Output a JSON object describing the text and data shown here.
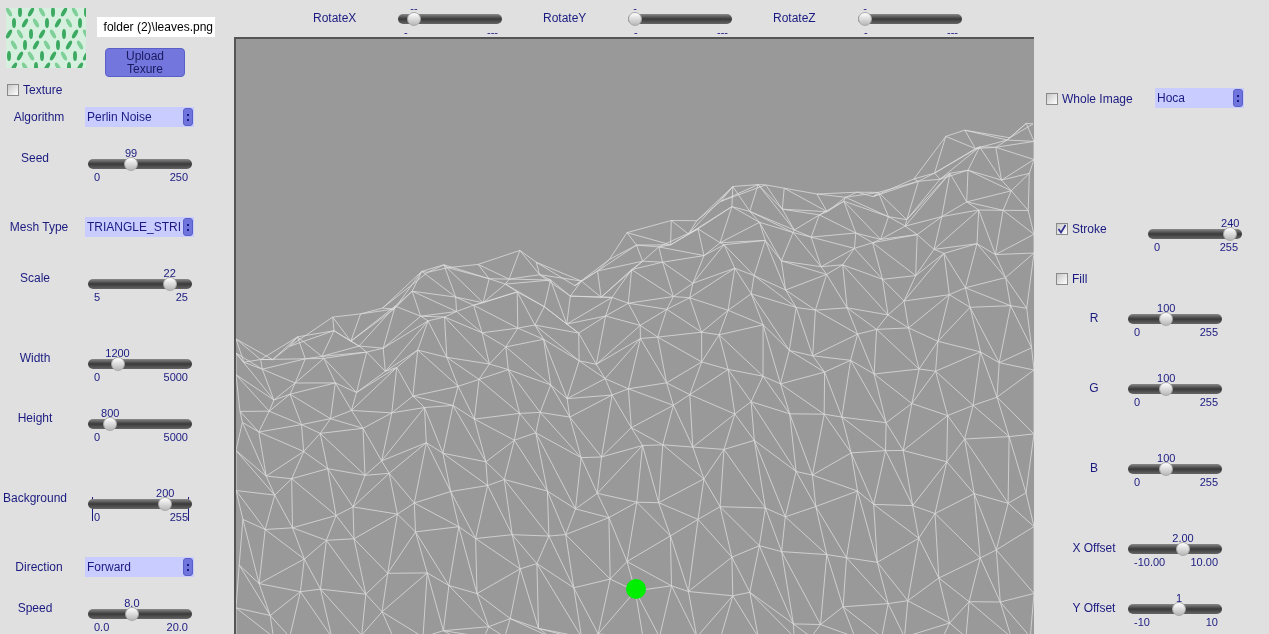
{
  "top_sliders": [
    {
      "label": "RotateX",
      "value": "--",
      "min": "-",
      "max": "---",
      "level": 0.1
    },
    {
      "label": "RotateY",
      "value": "-",
      "min": "-",
      "max": "---",
      "level": 0.0
    },
    {
      "label": "RotateZ",
      "value": "-",
      "min": "-",
      "max": "---",
      "level": 0.0
    }
  ],
  "texture": {
    "file_path": "folder (2)\\leaves.png",
    "upload_button": "Upload Texure",
    "checkbox": {
      "label": "Texture",
      "checked": false
    }
  },
  "left_controls": [
    {
      "kind": "dropdown",
      "label": "Algorithm",
      "value": "Perlin Noise"
    },
    {
      "kind": "slider",
      "label": "Seed",
      "value": "99",
      "min": "0",
      "max": "250",
      "level": 0.4,
      "ticks": false
    },
    {
      "kind": "dropdown",
      "label": "Mesh Type",
      "value": "TRIANGLE_STRI"
    },
    {
      "kind": "slider",
      "label": "Scale",
      "value": "22",
      "min": "5",
      "max": "25",
      "level": 0.83,
      "ticks": false
    },
    {
      "kind": "slider",
      "label": "Width",
      "value": "1200",
      "min": "0",
      "max": "5000",
      "level": 0.25,
      "ticks": false
    },
    {
      "kind": "slider",
      "label": "Height",
      "value": "800",
      "min": "0",
      "max": "5000",
      "level": 0.17,
      "ticks": false
    },
    {
      "kind": "slider",
      "label": "Background",
      "value": "200",
      "min": "0",
      "max": "255",
      "level": 0.78,
      "ticks": true
    },
    {
      "kind": "dropdown",
      "label": "Direction",
      "value": "Forward"
    },
    {
      "kind": "slider",
      "label": "Speed",
      "value": "8.0",
      "min": "0.0",
      "max": "20.0",
      "level": 0.41,
      "ticks": false
    }
  ],
  "right_controls": [
    {
      "kind": "checkbox",
      "label": "Whole Image",
      "checked": false
    },
    {
      "kind": "dropdown",
      "value": "Hoca"
    },
    {
      "kind": "checkbox",
      "label": "Stroke",
      "checked": true
    },
    {
      "kind": "slider",
      "value": "240",
      "min": "0",
      "max": "255",
      "level": 0.94,
      "ticks": false
    },
    {
      "kind": "checkbox",
      "label": "Fill",
      "checked": false
    },
    {
      "kind": "slider",
      "label": "R",
      "value": "100",
      "min": "0",
      "max": "255",
      "level": 0.39,
      "ticks": false
    },
    {
      "kind": "slider",
      "label": "G",
      "value": "100",
      "min": "0",
      "max": "255",
      "level": 0.39,
      "ticks": false
    },
    {
      "kind": "slider",
      "label": "B",
      "value": "100",
      "min": "0",
      "max": "255",
      "level": 0.39,
      "ticks": false
    },
    {
      "kind": "slider",
      "label": "X Offset",
      "value": "2.00",
      "min": "-10.00",
      "max": "10.00",
      "level": 0.6,
      "ticks": false
    },
    {
      "kind": "slider",
      "label": "Y Offset",
      "value": "1",
      "min": "-10",
      "max": "10",
      "level": 0.55,
      "ticks": false
    }
  ]
}
